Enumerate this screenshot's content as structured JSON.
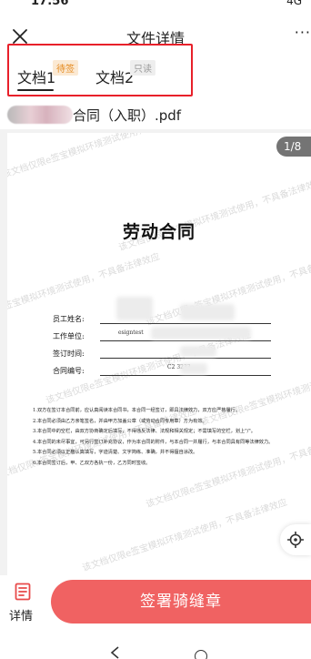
{
  "status_bar": {
    "time": "17:56",
    "right": "4G"
  },
  "nav": {
    "title": "文件详情",
    "more": "···"
  },
  "tabs": [
    {
      "label": "文档1",
      "badge": "待签"
    },
    {
      "label": "文档2",
      "badge": "只读"
    }
  ],
  "file": {
    "name": "合同（入职）.pdf"
  },
  "viewer": {
    "page_indicator": "1/8"
  },
  "watermark": "该文档仅限e签宝模拟环境测试使用，不具备法律效应",
  "document": {
    "title": "劳动合同",
    "fields": [
      {
        "label": "员工姓名:",
        "value": ""
      },
      {
        "label": "工作单位:",
        "value": "esigntest"
      },
      {
        "label": "签订时间:",
        "value": ""
      },
      {
        "label": "合同编号:",
        "value": "C2          3233"
      }
    ],
    "clauses": [
      "1.双方在签订本合同前，应认真阅读本合同书，本合同一经签订，即具法律效力，双方应严格履行。",
      "2.本合同必须由乙方亲笔签名，并由甲方加盖公章（或劳动合同专用章）方为有效。",
      "3.本合同中的空栏，由双方协商确定后填写，不得违反法律、法规和相关规定；不需填写的空栏，划上\"/\"。",
      "4.本合同的未尽事宜，可另行签订补充协议，作为本合同的附件，与本合同一并履行，与本合同具有同等法律效力。",
      "5.本合同必须以正楷认真填写，字迹清楚、文字简练、准确，并不得擅自涂改。",
      "6.本合同签订后，甲、乙双方各执一份，乙方同时签收。"
    ]
  },
  "bottom": {
    "detail_label": "详情",
    "sign_button": "签署骑缝章"
  },
  "colors": {
    "accent": "#f06262",
    "highlight_border": "#e8202a",
    "badge_pending": "#e58a1f"
  }
}
